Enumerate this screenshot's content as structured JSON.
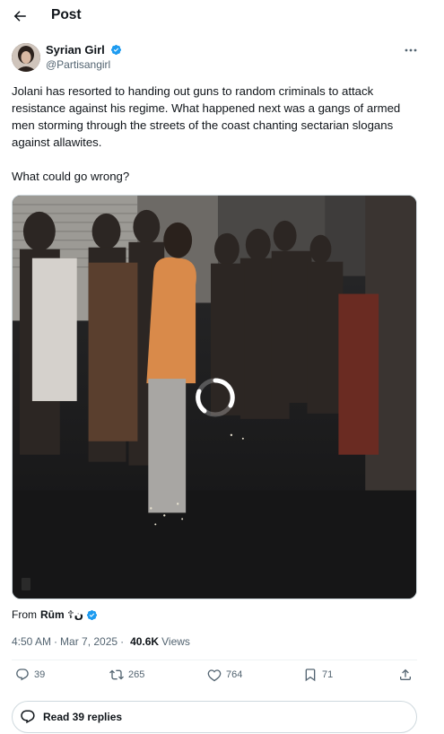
{
  "header": {
    "title": "Post",
    "back_icon": "arrow-left-icon"
  },
  "author": {
    "name": "Syrian Girl",
    "handle": "@Partisangirl",
    "verified": true,
    "verified_color": "#1d9bf0"
  },
  "tweet": {
    "text": "Jolani has resorted to handing out guns to random criminals to attack resistance against his regime. What happened next was a gangs of armed men storming through the streets of the coast chanting sectarian slogans against allawites.\n\nWhat could go wrong?"
  },
  "media": {
    "type": "video",
    "state_icon": "loading-spinner-icon"
  },
  "source": {
    "label": "From",
    "name": "Rūm ☦︎ن",
    "verified": true
  },
  "meta": {
    "time": "4:50 AM",
    "separator": "·",
    "date": "Mar 7, 2025",
    "views_count": "40.6K",
    "views_label": "Views"
  },
  "actions": {
    "replies": "39",
    "reposts": "265",
    "likes": "764",
    "bookmarks": "71"
  },
  "read_replies": {
    "label": "Read 39 replies"
  },
  "colors": {
    "text": "#0f1419",
    "muted": "#536471",
    "accent": "#1d9bf0",
    "border": "#cfd9de"
  }
}
